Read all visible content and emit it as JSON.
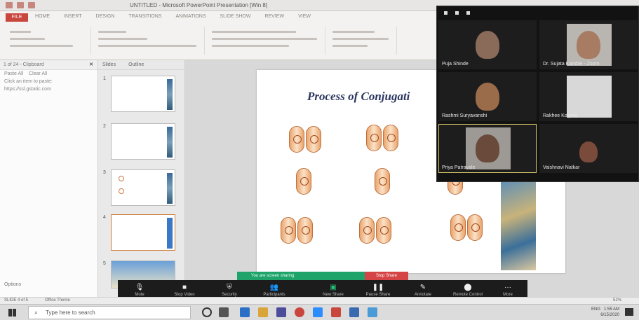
{
  "window": {
    "title": "UNTITLED - Microsoft PowerPoint Presentation [Win 8]"
  },
  "ribbon": {
    "file_tab": "FILE",
    "tabs": [
      "HOME",
      "INSERT",
      "DESIGN",
      "TRANSITIONS",
      "ANIMATIONS",
      "SLIDE SHOW",
      "REVIEW",
      "VIEW"
    ]
  },
  "clipboard_panel": {
    "header": "1 of 24 - Clipboard",
    "paste_all": "Paste All",
    "clear_all": "Clear All",
    "hint": "Click an item to paste:",
    "item": "https://ssl.gstatic.com",
    "options": "Options"
  },
  "thumbs_panel": {
    "tab_slides": "Slides",
    "tab_outline": "Outline",
    "numbers": [
      "1",
      "2",
      "3",
      "4",
      "5"
    ]
  },
  "slide": {
    "title": "Process of Conjugati"
  },
  "zoom": {
    "participants": [
      {
        "name": "Puja Shinde"
      },
      {
        "name": "Dr. Sujata Kamble - Zoom"
      },
      {
        "name": "Rashmi Suryavanshi"
      },
      {
        "name": "Rakhee Kolpote"
      },
      {
        "name": "Priya Patravale"
      },
      {
        "name": "Vaishnavi Natkar"
      }
    ],
    "controls": [
      {
        "icon": "mic-icon",
        "label": "Mute"
      },
      {
        "icon": "video-icon",
        "label": "Stop Video"
      },
      {
        "icon": "shield-icon",
        "label": "Security"
      },
      {
        "icon": "participants-icon",
        "label": "Participants"
      },
      {
        "icon": "share-icon",
        "label": "New Share"
      },
      {
        "icon": "pause-icon",
        "label": "Pause Share"
      },
      {
        "icon": "annotate-icon",
        "label": "Annotate"
      },
      {
        "icon": "remote-icon",
        "label": "Remote Control"
      },
      {
        "icon": "more-icon",
        "label": "More"
      }
    ],
    "banner_text": "You are screen sharing",
    "stop_share": "Stop Share"
  },
  "statusbar": {
    "slide_info": "SLIDE 4 of 5",
    "theme": "Office Theme",
    "zoom": "52%"
  },
  "taskbar": {
    "search_placeholder": "Type here to search",
    "time": "1:55 AM",
    "date": "6/15/2020",
    "lang": "ENG"
  },
  "colors": {
    "ppt_red": "#c9463d",
    "zoom_dark": "#1c1c1c",
    "share_green": "#1ea36b",
    "stop_red": "#d64545"
  }
}
